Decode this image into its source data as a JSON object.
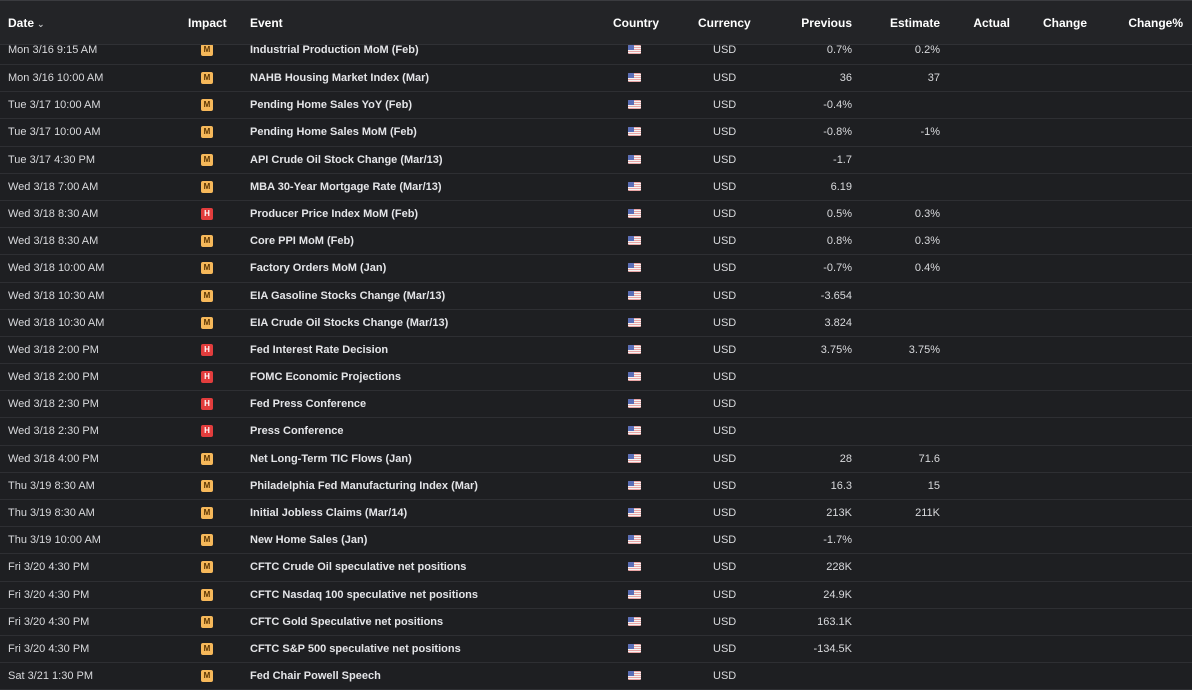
{
  "header": {
    "date": "Date",
    "impact": "Impact",
    "event": "Event",
    "country": "Country",
    "currency": "Currency",
    "previous": "Previous",
    "estimate": "Estimate",
    "actual": "Actual",
    "change": "Change",
    "change_pct": "Change%",
    "sort_icon": "chevron-down-icon"
  },
  "colors": {
    "background": "#1e1f22",
    "impact_medium": "#f6b85a",
    "impact_high": "#e23d3d"
  },
  "rows": [
    {
      "date": "Mon 3/16 9:15 AM",
      "impact": "M",
      "event": "Industrial Production MoM (Feb)",
      "currency": "USD",
      "previous": "0.7%",
      "estimate": "0.2%",
      "actual": "",
      "change": "",
      "change_pct": ""
    },
    {
      "date": "Mon 3/16 10:00 AM",
      "impact": "M",
      "event": "NAHB Housing Market Index (Mar)",
      "currency": "USD",
      "previous": "36",
      "estimate": "37",
      "actual": "",
      "change": "",
      "change_pct": ""
    },
    {
      "date": "Tue 3/17 10:00 AM",
      "impact": "M",
      "event": "Pending Home Sales YoY (Feb)",
      "currency": "USD",
      "previous": "-0.4%",
      "estimate": "",
      "actual": "",
      "change": "",
      "change_pct": ""
    },
    {
      "date": "Tue 3/17 10:00 AM",
      "impact": "M",
      "event": "Pending Home Sales MoM (Feb)",
      "currency": "USD",
      "previous": "-0.8%",
      "estimate": "-1%",
      "actual": "",
      "change": "",
      "change_pct": ""
    },
    {
      "date": "Tue 3/17 4:30 PM",
      "impact": "M",
      "event": "API Crude Oil Stock Change (Mar/13)",
      "currency": "USD",
      "previous": "-1.7",
      "estimate": "",
      "actual": "",
      "change": "",
      "change_pct": ""
    },
    {
      "date": "Wed 3/18 7:00 AM",
      "impact": "M",
      "event": "MBA 30-Year Mortgage Rate (Mar/13)",
      "currency": "USD",
      "previous": "6.19",
      "estimate": "",
      "actual": "",
      "change": "",
      "change_pct": ""
    },
    {
      "date": "Wed 3/18 8:30 AM",
      "impact": "H",
      "event": "Producer Price Index MoM (Feb)",
      "currency": "USD",
      "previous": "0.5%",
      "estimate": "0.3%",
      "actual": "",
      "change": "",
      "change_pct": ""
    },
    {
      "date": "Wed 3/18 8:30 AM",
      "impact": "M",
      "event": "Core PPI MoM (Feb)",
      "currency": "USD",
      "previous": "0.8%",
      "estimate": "0.3%",
      "actual": "",
      "change": "",
      "change_pct": ""
    },
    {
      "date": "Wed 3/18 10:00 AM",
      "impact": "M",
      "event": "Factory Orders MoM (Jan)",
      "currency": "USD",
      "previous": "-0.7%",
      "estimate": "0.4%",
      "actual": "",
      "change": "",
      "change_pct": ""
    },
    {
      "date": "Wed 3/18 10:30 AM",
      "impact": "M",
      "event": "EIA Gasoline Stocks Change (Mar/13)",
      "currency": "USD",
      "previous": "-3.654",
      "estimate": "",
      "actual": "",
      "change": "",
      "change_pct": ""
    },
    {
      "date": "Wed 3/18 10:30 AM",
      "impact": "M",
      "event": "EIA Crude Oil Stocks Change (Mar/13)",
      "currency": "USD",
      "previous": "3.824",
      "estimate": "",
      "actual": "",
      "change": "",
      "change_pct": ""
    },
    {
      "date": "Wed 3/18 2:00 PM",
      "impact": "H",
      "event": "Fed Interest Rate Decision",
      "currency": "USD",
      "previous": "3.75%",
      "estimate": "3.75%",
      "actual": "",
      "change": "",
      "change_pct": ""
    },
    {
      "date": "Wed 3/18 2:00 PM",
      "impact": "H",
      "event": "FOMC Economic Projections",
      "currency": "USD",
      "previous": "",
      "estimate": "",
      "actual": "",
      "change": "",
      "change_pct": ""
    },
    {
      "date": "Wed 3/18 2:30 PM",
      "impact": "H",
      "event": "Fed Press Conference",
      "currency": "USD",
      "previous": "",
      "estimate": "",
      "actual": "",
      "change": "",
      "change_pct": ""
    },
    {
      "date": "Wed 3/18 2:30 PM",
      "impact": "H",
      "event": "Press Conference",
      "currency": "USD",
      "previous": "",
      "estimate": "",
      "actual": "",
      "change": "",
      "change_pct": ""
    },
    {
      "date": "Wed 3/18 4:00 PM",
      "impact": "M",
      "event": "Net Long-Term TIC Flows (Jan)",
      "currency": "USD",
      "previous": "28",
      "estimate": "71.6",
      "actual": "",
      "change": "",
      "change_pct": ""
    },
    {
      "date": "Thu 3/19 8:30 AM",
      "impact": "M",
      "event": "Philadelphia Fed Manufacturing Index (Mar)",
      "currency": "USD",
      "previous": "16.3",
      "estimate": "15",
      "actual": "",
      "change": "",
      "change_pct": ""
    },
    {
      "date": "Thu 3/19 8:30 AM",
      "impact": "M",
      "event": "Initial Jobless Claims (Mar/14)",
      "currency": "USD",
      "previous": "213K",
      "estimate": "211K",
      "actual": "",
      "change": "",
      "change_pct": ""
    },
    {
      "date": "Thu 3/19 10:00 AM",
      "impact": "M",
      "event": "New Home Sales (Jan)",
      "currency": "USD",
      "previous": "-1.7%",
      "estimate": "",
      "actual": "",
      "change": "",
      "change_pct": ""
    },
    {
      "date": "Fri 3/20 4:30 PM",
      "impact": "M",
      "event": "CFTC Crude Oil speculative net positions",
      "currency": "USD",
      "previous": "228K",
      "estimate": "",
      "actual": "",
      "change": "",
      "change_pct": ""
    },
    {
      "date": "Fri 3/20 4:30 PM",
      "impact": "M",
      "event": "CFTC Nasdaq 100 speculative net positions",
      "currency": "USD",
      "previous": "24.9K",
      "estimate": "",
      "actual": "",
      "change": "",
      "change_pct": ""
    },
    {
      "date": "Fri 3/20 4:30 PM",
      "impact": "M",
      "event": "CFTC Gold Speculative net positions",
      "currency": "USD",
      "previous": "163.1K",
      "estimate": "",
      "actual": "",
      "change": "",
      "change_pct": ""
    },
    {
      "date": "Fri 3/20 4:30 PM",
      "impact": "M",
      "event": "CFTC S&P 500 speculative net positions",
      "currency": "USD",
      "previous": "-134.5K",
      "estimate": "",
      "actual": "",
      "change": "",
      "change_pct": ""
    },
    {
      "date": "Sat 3/21 1:30 PM",
      "impact": "M",
      "event": "Fed Chair Powell Speech",
      "currency": "USD",
      "previous": "",
      "estimate": "",
      "actual": "",
      "change": "",
      "change_pct": ""
    }
  ]
}
